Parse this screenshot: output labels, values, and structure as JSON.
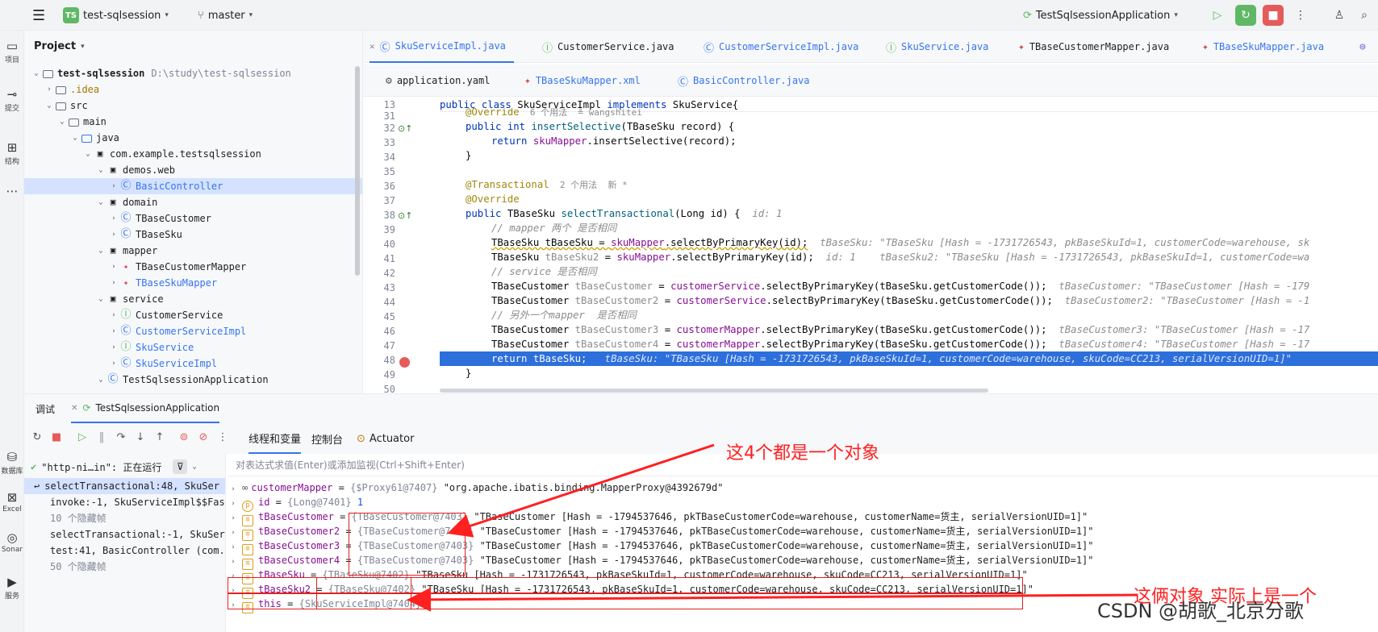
{
  "topbar": {
    "project_badge": "TS",
    "project_name": "test-sqlsession",
    "branch": "master",
    "run_config": "TestSqlsessionApplication"
  },
  "leftstrip": {
    "project": "项目",
    "commit": "提交",
    "structure": "结构",
    "database": "数据库",
    "excel": "Excel",
    "sonar": "Sonar",
    "services": "服务"
  },
  "project_panel": {
    "title": "Project",
    "tree": [
      {
        "label": "test-sqlsession",
        "path": "D:\\study\\test-sqlsession"
      },
      {
        "label": ".idea"
      },
      {
        "label": "src"
      },
      {
        "label": "main"
      },
      {
        "label": "java"
      },
      {
        "label": "com.example.testsqlsession"
      },
      {
        "label": "demos.web"
      },
      {
        "label": "BasicController"
      },
      {
        "label": "domain"
      },
      {
        "label": "TBaseCustomer"
      },
      {
        "label": "TBaseSku"
      },
      {
        "label": "mapper"
      },
      {
        "label": "TBaseCustomerMapper"
      },
      {
        "label": "TBaseSkuMapper"
      },
      {
        "label": "service"
      },
      {
        "label": "CustomerService"
      },
      {
        "label": "CustomerServiceImpl"
      },
      {
        "label": "SkuService"
      },
      {
        "label": "SkuServiceImpl"
      },
      {
        "label": "TestSqlsessionApplication"
      }
    ]
  },
  "editor_tabs": [
    "SkuServiceImpl.java",
    "CustomerService.java",
    "CustomerServiceImpl.java",
    "SkuService.java",
    "TBaseCustomerMapper.java",
    "TBaseSkuMapper.java",
    "application.yaml",
    "TBaseSkuMapper.xml",
    "BasicController.java"
  ],
  "code": {
    "line_numbers": [
      "13",
      "31",
      "32",
      "33",
      "34",
      "35",
      "36",
      "37",
      "38",
      "39",
      "40",
      "41",
      "42",
      "43",
      "44",
      "45",
      "46",
      "47",
      "48",
      "49",
      "50"
    ],
    "header": {
      "p1": "public class ",
      "p2": "SkuServiceImpl ",
      "p3": "implements ",
      "p4": "SkuService{"
    },
    "l31": {
      "p1": "@Override",
      "hint": "  6 个用法  ≗ wangshitei"
    },
    "l32": {
      "p1": "public int ",
      "p2": "insertSelective",
      "p3": "(TBaseSku record) {"
    },
    "l33": {
      "p1": "return ",
      "p2": "skuMapper",
      "p3": ".insertSelective(record);"
    },
    "l34": "}",
    "l36": {
      "p1": "@Transactional",
      "hint": "  2 个用法  新 *"
    },
    "l37": "@Override",
    "l38": {
      "p1": "public ",
      "p2": "TBaseSku ",
      "p3": "selectTransactional",
      "p4": "(Long id) {",
      "inl": "  id: 1"
    },
    "l39": "// mapper 两个 是否相同",
    "l40": {
      "p1": "TBaseSku tBaseSku = ",
      "p2": "skuMapper",
      "p3": ".selectByPrimaryKey(id);",
      "inl": "  tBaseSku: \"TBaseSku [Hash = -1731726543, pkBaseSkuId=1, customerCode=warehouse, sk"
    },
    "l41": {
      "p1": "TBaseSku ",
      "p2": "tBaseSku2",
      "p3": " = ",
      "p4": "skuMapper",
      "p5": ".selectByPrimaryKey(id);",
      "inl": "  id: 1    tBaseSku2: \"TBaseSku [Hash = -1731726543, pkBaseSkuId=1, customerCode=wa"
    },
    "l42": "// service 是否相同",
    "l43": {
      "p1": "TBaseCustomer ",
      "p2": "tBaseCustomer",
      "p3": " = ",
      "p4": "customerService",
      "p5": ".selectByPrimaryKey(tBaseSku.getCustomerCode());",
      "inl": "  tBaseCustomer: \"TBaseCustomer [Hash = -179"
    },
    "l44": {
      "p1": "TBaseCustomer ",
      "p2": "tBaseCustomer2",
      "p3": " = ",
      "p4": "customerService",
      "p5": ".selectByPrimaryKey(tBaseSku.getCustomerCode());",
      "inl": "  tBaseCustomer2: \"TBaseCustomer [Hash = -1"
    },
    "l45": "// 另外一个mapper  是否相同",
    "l46": {
      "p1": "TBaseCustomer ",
      "p2": "tBaseCustomer3",
      "p3": " = ",
      "p4": "customerMapper",
      "p5": ".selectByPrimaryKey(tBaseSku.getCustomerCode());",
      "inl": "  tBaseCustomer3: \"TBaseCustomer [Hash = -17"
    },
    "l47": {
      "p1": "TBaseCustomer ",
      "p2": "tBaseCustomer4",
      "p3": " = ",
      "p4": "customerMapper",
      "p5": ".selectByPrimaryKey(tBaseSku.getCustomerCode());",
      "inl": "  tBaseCustomer4: \"TBaseCustomer [Hash = -17"
    },
    "l48": {
      "p1": "return tBaseSku;",
      "inl": "   tBaseSku: \"TBaseSku [Hash = -1731726543, pkBaseSkuId=1, customerCode=warehouse, skuCode=CC213, serialVersionUID=1]\""
    },
    "l49": "}"
  },
  "debug": {
    "tab_debug": "调试",
    "tab_session": "TestSqlsessionApplication",
    "subtab_threads": "线程和变量",
    "subtab_console": "控制台",
    "subtab_actuator": "Actuator",
    "thread_label": "\"http-ni…in\": 正在运行",
    "eval_placeholder": "对表达式求值(Enter)或添加监视(Ctrl+Shift+Enter)",
    "frames": [
      "selectTransactional:48, SkuSer",
      "invoke:-1, SkuServiceImpl$$Fas",
      "10 个隐藏帧",
      "selectTransactional:-1, SkuSer",
      "test:41, BasicController (com.",
      "50 个隐藏帧"
    ],
    "vars": [
      {
        "name": "customerMapper",
        "ref": "{$Proxy61@7407}",
        "value": "\"org.apache.ibatis.binding.MapperProxy@4392679d\""
      },
      {
        "name": "id",
        "ref": "{Long@7401}",
        "value": "1"
      },
      {
        "name": "tBaseCustomer",
        "ref": "{TBaseCustomer@7403}",
        "value": "\"TBaseCustomer [Hash = -1794537646, pkTBaseCustomerCode=warehouse, customerName=货主, serialVersionUID=1]\""
      },
      {
        "name": "tBaseCustomer2",
        "ref": "{TBaseCustomer@7403}",
        "value": "\"TBaseCustomer [Hash = -1794537646, pkTBaseCustomerCode=warehouse, customerName=货主, serialVersionUID=1]\""
      },
      {
        "name": "tBaseCustomer3",
        "ref": "{TBaseCustomer@7403}",
        "value": "\"TBaseCustomer [Hash = -1794537646, pkTBaseCustomerCode=warehouse, customerName=货主, serialVersionUID=1]\""
      },
      {
        "name": "tBaseCustomer4",
        "ref": "{TBaseCustomer@7403}",
        "value": "\"TBaseCustomer [Hash = -1794537646, pkTBaseCustomerCode=warehouse, customerName=货主, serialVersionUID=1]\""
      },
      {
        "name": "tBaseSku",
        "ref": "{TBaseSku@7402}",
        "value": "\"TBaseSku [Hash = -1731726543, pkBaseSkuId=1, customerCode=warehouse, skuCode=CC213, serialVersionUID=1]\""
      },
      {
        "name": "tBaseSku2",
        "ref": "{TBaseSku@7402}",
        "value": "\"TBaseSku [Hash = -1731726543, pkBaseSkuId=1, customerCode=warehouse, skuCode=CC213, serialVersionUID=1]\""
      },
      {
        "name": "this",
        "ref": "{SkuServiceImpl@7404}",
        "value": ""
      }
    ]
  },
  "annotations": {
    "note1": "这4个都是一个对象",
    "note2": "这俩对象 实际上是一个",
    "watermark": "CSDN @胡歌_北京分歌"
  },
  "colors": {
    "accent": "#3574f0",
    "highlight_line": "#2d6fdb",
    "annotation": "#ff2020",
    "run_green": "#5fb865",
    "stop_red": "#e55b5b"
  }
}
